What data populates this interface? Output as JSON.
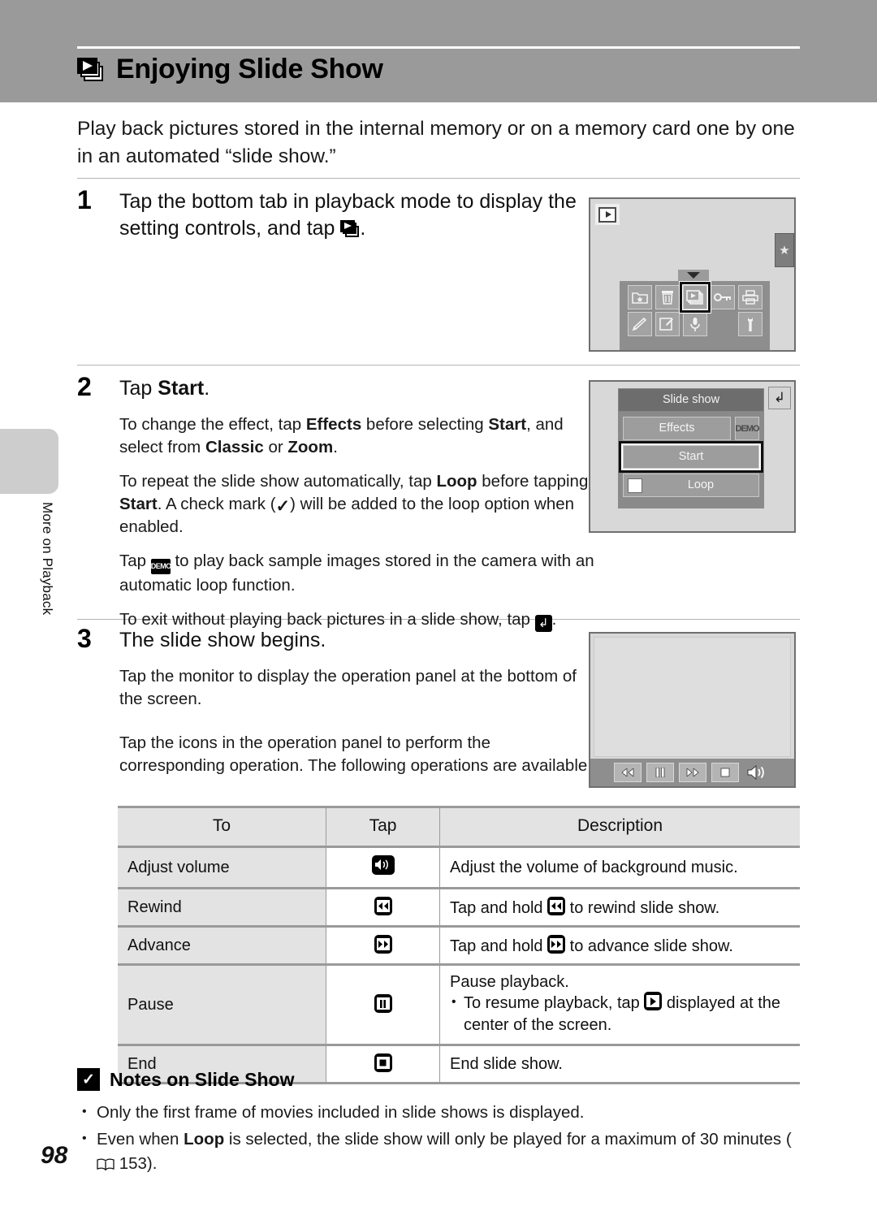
{
  "header": {
    "title": "Enjoying Slide Show",
    "icon": "slideshow-stacked-icon"
  },
  "sidebar": {
    "section_label": "More on Playback",
    "page_number": "98"
  },
  "intro": "Play back pictures stored in the internal memory or on a memory card one by one in an automated “slide show.”",
  "steps": [
    {
      "number": "1",
      "lead_part1": "Tap the bottom tab in playback mode to display the setting controls, and tap",
      "lead_part2": "."
    },
    {
      "number": "2",
      "lead_prefix": "Tap ",
      "lead_bold": "Start",
      "lead_suffix": ".",
      "paragraphs": [
        {
          "segments": [
            {
              "t": "To change the effect, tap ",
              "b": false
            },
            {
              "t": "Effects",
              "b": true
            },
            {
              "t": " before selecting ",
              "b": false
            },
            {
              "t": "Start",
              "b": true
            },
            {
              "t": ", and select from ",
              "b": false
            },
            {
              "t": "Classic",
              "b": true
            },
            {
              "t": " or ",
              "b": false
            },
            {
              "t": "Zoom",
              "b": true
            },
            {
              "t": ".",
              "b": false
            }
          ]
        }
      ],
      "p2_a": "To repeat the slide show automatically, tap ",
      "p2_loop": "Loop",
      "p2_b": " before tapping ",
      "p2_start": "Start",
      "p2_c": ". A check mark (",
      "p2_d": ") will be added to the loop option when enabled.",
      "p3_a": "Tap ",
      "p3_b": " to play back sample images stored in the camera with an automatic loop function.",
      "p4_a": "To exit without playing back pictures in a slide show, tap ",
      "p4_b": "."
    },
    {
      "number": "3",
      "lead": "The slide show begins.",
      "p1": "Tap the monitor to display the operation panel at the bottom of the screen.",
      "p2": "Tap the icons in the operation panel to perform the corresponding operation. The following operations are available."
    }
  ],
  "screen1": {
    "playback_icon": "playback-mode-icon",
    "favorites_tab": "★",
    "tab_arrow": "chevron-down-icon",
    "icons_row1": [
      "favorites-folder-icon",
      "delete-trash-icon",
      "slide-show-icon",
      "protect-key-icon",
      "print-order-icon"
    ],
    "icons_row2": [
      "paint-icon",
      "edit-image-icon",
      "voice-memo-icon",
      "setup-wrench-icon"
    ],
    "selected_icon": "slide-show-icon"
  },
  "screen2": {
    "title": "Slide show",
    "effects_label": "Effects",
    "demo_label": "DEMO",
    "start_label": "Start",
    "loop_label": "Loop",
    "back_icon": "back-arrow-icon",
    "loop_checked": false,
    "selected": "Start"
  },
  "screen3": {
    "panel_buttons": [
      "rewind-icon",
      "pause-icon",
      "advance-icon",
      "end-icon",
      "volume-icon"
    ]
  },
  "table": {
    "headers": [
      "To",
      "Tap",
      "Description"
    ],
    "rows": [
      {
        "to": "Adjust volume",
        "tap_icon": "volume-icon",
        "tap_glyph": "volume",
        "description": "Adjust the volume of background music.",
        "desc_type": "inline_icon_none"
      },
      {
        "to": "Rewind",
        "tap_icon": "rewind-icon",
        "tap_glyph": "rewind",
        "desc_a": "Tap and hold ",
        "desc_b": " to rewind slide show.",
        "desc_type": "inline_icon"
      },
      {
        "to": "Advance",
        "tap_icon": "advance-icon",
        "tap_glyph": "advance",
        "desc_a": "Tap and hold ",
        "desc_b": " to advance slide show.",
        "desc_type": "inline_icon"
      },
      {
        "to": "Pause",
        "tap_icon": "pause-icon",
        "tap_glyph": "pause",
        "desc_line1": "Pause playback.",
        "desc_a": "To resume playback, tap ",
        "desc_b": " displayed at the center of the screen.",
        "desc_type": "bulleted"
      },
      {
        "to": "End",
        "tap_icon": "end-icon",
        "tap_glyph": "end",
        "description": "End slide show.",
        "desc_type": "plain"
      }
    ]
  },
  "notes": {
    "heading": "Notes on Slide Show",
    "warn_icon": "caution-check-icon",
    "items": [
      {
        "type": "plain",
        "text": "Only the first frame of movies included in slide shows is displayed."
      },
      {
        "type": "rich",
        "a": "Even when ",
        "bold": "Loop",
        "b": " is selected, the slide show will only be played for a maximum of 30 minutes (",
        "ref": "153",
        "c": ")."
      }
    ]
  },
  "colors": {
    "header_band": "#9a9a9a",
    "rule": "#b4b4b4",
    "table_shade": "#e3e3e3",
    "screen_bg": "#d8d8d8",
    "menu_gray": "#8a8a8a"
  }
}
